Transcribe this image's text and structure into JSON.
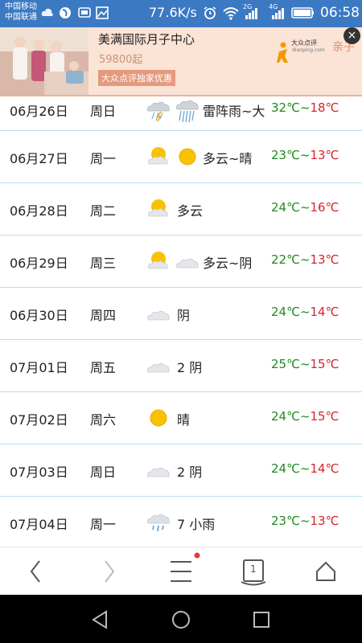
{
  "status_bar": {
    "carrier1": "中国移动",
    "carrier2": "中国联通",
    "speed": "77.6K/s",
    "net1": "2G",
    "net2": "4G",
    "time": "06:58"
  },
  "ad": {
    "title": "美满国际月子中心",
    "price": "59800起",
    "tag": "大众点评独家优惠",
    "logo_text": "大众点评",
    "logo_sub": "dianping.com",
    "category": "亲子",
    "close_label": "×"
  },
  "forecast": [
    {
      "date": "06月26日",
      "weekday": "周日",
      "icons": [
        "thunderstorm-icon",
        "heavy-rain-icon"
      ],
      "condition": "雷阵雨~大",
      "high": "32℃",
      "low": "18℃"
    },
    {
      "date": "06月27日",
      "weekday": "周一",
      "icons": [
        "partly-cloudy-icon",
        "sunny-icon"
      ],
      "condition": "多云~晴",
      "high": "23℃",
      "low": "13℃"
    },
    {
      "date": "06月28日",
      "weekday": "周二",
      "icons": [
        "partly-cloudy-icon"
      ],
      "condition": "多云",
      "high": "24℃",
      "low": "16℃"
    },
    {
      "date": "06月29日",
      "weekday": "周三",
      "icons": [
        "partly-cloudy-icon",
        "overcast-icon"
      ],
      "condition": "多云~阴",
      "high": "22℃",
      "low": "13℃"
    },
    {
      "date": "06月30日",
      "weekday": "周四",
      "icons": [
        "overcast-icon"
      ],
      "condition": "阴",
      "high": "24℃",
      "low": "14℃"
    },
    {
      "date": "07月01日",
      "weekday": "周五",
      "icons": [
        "overcast-icon"
      ],
      "condition": "2 阴",
      "high": "25℃",
      "low": "15℃"
    },
    {
      "date": "07月02日",
      "weekday": "周六",
      "icons": [
        "sunny-icon"
      ],
      "condition": "晴",
      "high": "24℃",
      "low": "15℃"
    },
    {
      "date": "07月03日",
      "weekday": "周日",
      "icons": [
        "overcast-icon"
      ],
      "condition": "2 阴",
      "high": "24℃",
      "low": "14℃"
    },
    {
      "date": "07月04日",
      "weekday": "周一",
      "icons": [
        "light-rain-icon"
      ],
      "condition": "7 小雨",
      "high": "23℃",
      "low": "13℃"
    }
  ],
  "temp_separator": "~",
  "browser_nav": {
    "tabs_count": "1"
  },
  "colors": {
    "status_bar": "#3b79c3",
    "high_temp": "#1f8a1f",
    "low_temp": "#d3262b",
    "row_divider": "#b7dff1"
  }
}
